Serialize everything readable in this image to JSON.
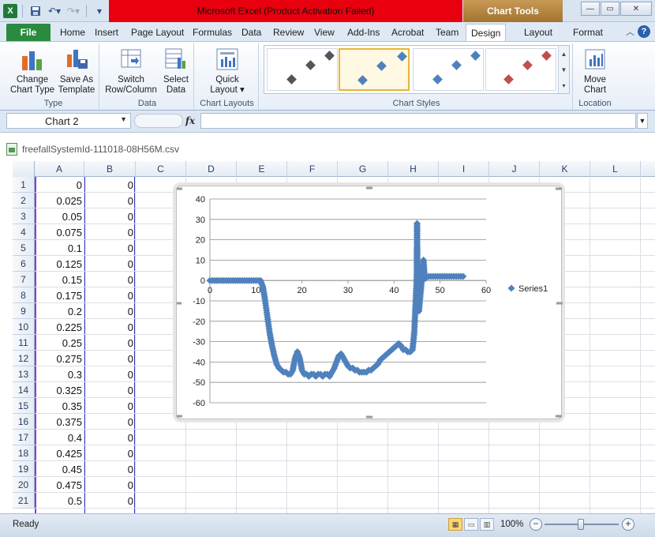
{
  "title_bar": {
    "title": "Microsoft Excel (Product Activation Failed)",
    "contextual_tab_group": "Chart Tools",
    "qat_icons": [
      "excel-logo-icon",
      "save-icon",
      "undo-icon",
      "redo-icon",
      "customize-qat-icon"
    ],
    "logo_letter": "X"
  },
  "ribbon_tabs": [
    "File",
    "Home",
    "Insert",
    "Page Layout",
    "Formulas",
    "Data",
    "Review",
    "View",
    "Add-Ins",
    "Acrobat",
    "Team",
    "Design",
    "Layout",
    "Format"
  ],
  "active_tab": "Design",
  "ribbon": {
    "groups": [
      {
        "label": "Type",
        "buttons": [
          "Change Chart Type",
          "Save As Template"
        ]
      },
      {
        "label": "Data",
        "buttons": [
          "Switch Row/Column",
          "Select Data"
        ]
      },
      {
        "label": "Chart Layouts",
        "buttons": [
          "Quick Layout"
        ]
      },
      {
        "label": "Chart Styles",
        "buttons": []
      },
      {
        "label": "Location",
        "buttons": [
          "Move Chart"
        ]
      }
    ],
    "change_chart_type": [
      "Change",
      "Chart Type"
    ],
    "save_as_template": [
      "Save As",
      "Template"
    ],
    "switch_row_column": [
      "Switch",
      "Row/Column"
    ],
    "select_data": [
      "Select",
      "Data"
    ],
    "quick_layout": [
      "Quick",
      "Layout ▾"
    ],
    "move_chart": [
      "Move",
      "Chart"
    ],
    "chart_styles": [
      {
        "dot_color": "#555555",
        "selected": false
      },
      {
        "dot_color": "#4f81bd",
        "selected": true
      },
      {
        "dot_color": "#4f81bd",
        "selected": false
      },
      {
        "dot_color": "#c0504d",
        "selected": false
      }
    ]
  },
  "formula_bar": {
    "name_box": "Chart 2",
    "fx_label": "fx",
    "formula": ""
  },
  "workbook": {
    "filename": "freefallSystemId-111018-08H56M.csv",
    "columns": [
      "A",
      "B",
      "C",
      "D",
      "E",
      "F",
      "G",
      "H",
      "I",
      "J",
      "K",
      "L"
    ],
    "rows": [
      {
        "n": "1",
        "a": "0",
        "b": "0"
      },
      {
        "n": "2",
        "a": "0.025",
        "b": "0"
      },
      {
        "n": "3",
        "a": "0.05",
        "b": "0"
      },
      {
        "n": "4",
        "a": "0.075",
        "b": "0"
      },
      {
        "n": "5",
        "a": "0.1",
        "b": "0"
      },
      {
        "n": "6",
        "a": "0.125",
        "b": "0"
      },
      {
        "n": "7",
        "a": "0.15",
        "b": "0"
      },
      {
        "n": "8",
        "a": "0.175",
        "b": "0"
      },
      {
        "n": "9",
        "a": "0.2",
        "b": "0"
      },
      {
        "n": "10",
        "a": "0.225",
        "b": "0"
      },
      {
        "n": "11",
        "a": "0.25",
        "b": "0"
      },
      {
        "n": "12",
        "a": "0.275",
        "b": "0"
      },
      {
        "n": "13",
        "a": "0.3",
        "b": "0"
      },
      {
        "n": "14",
        "a": "0.325",
        "b": "0"
      },
      {
        "n": "15",
        "a": "0.35",
        "b": "0"
      },
      {
        "n": "16",
        "a": "0.375",
        "b": "0"
      },
      {
        "n": "17",
        "a": "0.4",
        "b": "0"
      },
      {
        "n": "18",
        "a": "0.425",
        "b": "0"
      },
      {
        "n": "19",
        "a": "0.45",
        "b": "0"
      },
      {
        "n": "20",
        "a": "0.475",
        "b": "0"
      },
      {
        "n": "21",
        "a": "0.5",
        "b": "0"
      }
    ]
  },
  "chart_data": {
    "type": "scatter",
    "title": "",
    "xlabel": "",
    "ylabel": "",
    "xlim": [
      0,
      60
    ],
    "ylim": [
      -60,
      40
    ],
    "x_ticks": [
      "0",
      "10",
      "20",
      "30",
      "40",
      "50",
      "60"
    ],
    "y_ticks": [
      "40",
      "30",
      "20",
      "10",
      "0",
      "-10",
      "-20",
      "-30",
      "-40",
      "-50",
      "-60"
    ],
    "grid": true,
    "legend_position": "right",
    "marker": "diamond",
    "series": [
      {
        "name": "Series1",
        "color": "#4f81bd",
        "x": [
          0,
          1,
          2,
          3,
          4,
          5,
          6,
          7,
          8,
          9,
          10,
          11,
          11.5,
          12,
          12.5,
          13,
          13.5,
          14,
          14.5,
          15,
          15.5,
          16,
          16.5,
          17,
          17.5,
          18,
          18.5,
          19,
          19.5,
          20,
          20.5,
          21,
          21.5,
          22,
          22.5,
          23,
          23.5,
          24,
          24.5,
          25,
          25.5,
          26,
          26.5,
          27,
          27.5,
          28,
          28.5,
          29,
          29.5,
          30,
          30.5,
          31,
          31.5,
          32,
          32.5,
          33,
          33.5,
          34,
          34.5,
          35,
          35.5,
          36,
          36.5,
          37,
          37.5,
          38,
          38.5,
          39,
          39.5,
          40,
          40.5,
          41,
          41.5,
          42,
          42.5,
          43,
          43.5,
          44,
          44.2,
          44.4,
          44.6,
          44.8,
          45,
          45,
          45,
          45,
          45,
          45,
          45,
          45,
          45.2,
          45.4,
          45.6,
          45.8,
          46,
          46.2,
          46.4,
          46.6,
          46.8,
          47,
          47.5,
          48,
          48.5,
          49,
          49.5,
          50,
          50.5,
          51,
          51.5,
          52,
          52.5,
          53,
          53.5,
          54,
          54.5,
          55
        ],
        "y": [
          0,
          0,
          0,
          0,
          0,
          0,
          0,
          0,
          0,
          0,
          0,
          0,
          -3,
          -10,
          -18,
          -26,
          -32,
          -37,
          -41,
          -43,
          -44,
          -45,
          -45,
          -46,
          -46,
          -44,
          -38,
          -35,
          -38,
          -44,
          -46,
          -46,
          -47,
          -46,
          -46,
          -47,
          -46,
          -46,
          -47,
          -46,
          -46,
          -47,
          -45,
          -43,
          -40,
          -37,
          -36,
          -38,
          -40,
          -42,
          -43,
          -43,
          -44,
          -44,
          -45,
          -45,
          -45,
          -45,
          -44,
          -44,
          -43,
          -42,
          -41,
          -39,
          -38,
          -37,
          -36,
          -35,
          -34,
          -33,
          -32,
          -31,
          -32,
          -34,
          -34,
          -35,
          -35,
          -34,
          -30,
          -25,
          -15,
          -5,
          5,
          15,
          22,
          28,
          25,
          18,
          10,
          2,
          -8,
          -15,
          -10,
          -5,
          0,
          5,
          10,
          3,
          1,
          2,
          2,
          2,
          2,
          2,
          2,
          2,
          2,
          2,
          2,
          2,
          2,
          2,
          2,
          2,
          2,
          2
        ]
      }
    ]
  },
  "status_bar": {
    "ready": "Ready",
    "zoom": "100%",
    "zoom_fraction": 0.5
  }
}
